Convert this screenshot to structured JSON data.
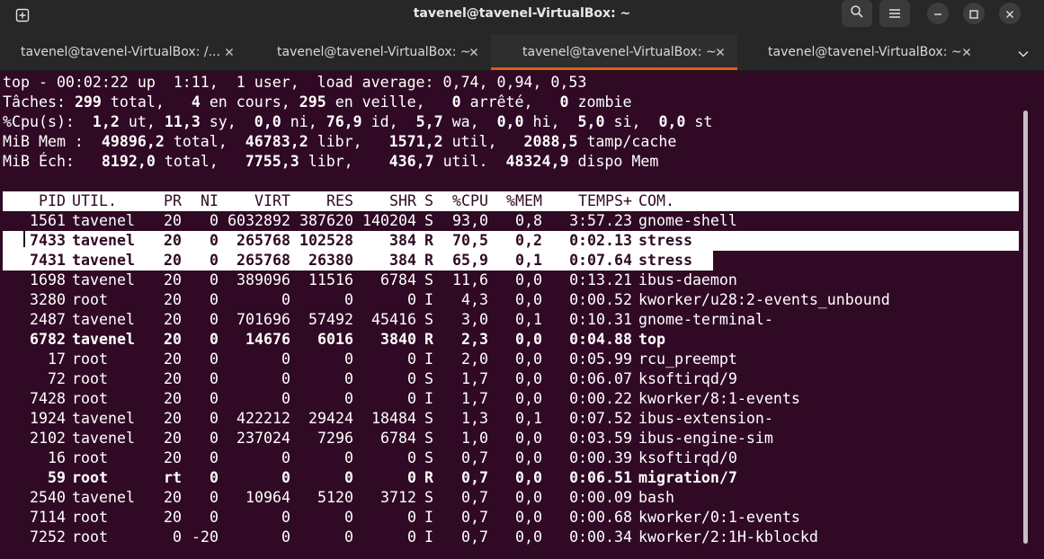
{
  "window": {
    "title": "tavenel@tavenel-VirtualBox: ~"
  },
  "tabs": [
    {
      "label": "tavenel@tavenel-VirtualBox: /...",
      "active": false
    },
    {
      "label": "tavenel@tavenel-VirtualBox: ~",
      "active": false
    },
    {
      "label": "tavenel@tavenel-VirtualBox: ~",
      "active": true
    },
    {
      "label": "tavenel@tavenel-VirtualBox: ~",
      "active": false
    }
  ],
  "icons": {
    "new_tab": "new-tab-icon",
    "search": "search-icon",
    "menu": "hamburger-menu-icon",
    "minimize": "minimize-icon",
    "maximize": "maximize-icon",
    "close": "close-icon",
    "tab_close": "close-icon",
    "tabs_menu": "chevron-down-icon"
  },
  "summary": {
    "line1": "top - 00:02:22 up  1:11,  1 user,  load average: 0,74, 0,94, 0,53",
    "tasks_label": "Tâches: ",
    "tasks_total": "299",
    "tasks_total_label": " total,   ",
    "tasks_running": "4",
    "tasks_running_label": " en cours, ",
    "tasks_sleeping": "295",
    "tasks_sleeping_label": " en veille,   ",
    "tasks_stopped": "0",
    "tasks_stopped_label": " arrêté,   ",
    "tasks_zombie": "0",
    "tasks_zombie_label": " zombie",
    "cpu_label": "%Cpu(s):  ",
    "cpu_us": "1,2",
    "cpu_us_label": " ut, ",
    "cpu_sy": "11,3",
    "cpu_sy_label": " sy,  ",
    "cpu_ni": "0,0",
    "cpu_ni_label": " ni, ",
    "cpu_id": "76,9",
    "cpu_id_label": " id,  ",
    "cpu_wa": "5,7",
    "cpu_wa_label": " wa,  ",
    "cpu_hi": "0,0",
    "cpu_hi_label": " hi,  ",
    "cpu_si": "5,0",
    "cpu_si_label": " si,  ",
    "cpu_st": "0,0",
    "cpu_st_label": " st",
    "mem_label": "MiB Mem :  ",
    "mem_total": "49896,2",
    "mem_total_label": " total,  ",
    "mem_free": "46783,2",
    "mem_free_label": " libr,   ",
    "mem_used": "1571,2",
    "mem_used_label": " util,   ",
    "mem_cache": "2088,5",
    "mem_cache_label": " tamp/cache",
    "swap_label": "MiB Éch:   ",
    "swap_total": "8192,0",
    "swap_total_label": " total,   ",
    "swap_free": "7755,3",
    "swap_free_label": " libr,    ",
    "swap_used": "436,7",
    "swap_used_label": " util.  ",
    "swap_avail": "48324,9",
    "swap_avail_label": " dispo Mem"
  },
  "table": {
    "headers": [
      "PID",
      "UTIL.",
      "PR",
      "NI",
      "VIRT",
      "RES",
      "SHR",
      "S",
      "%CPU",
      "%MEM",
      "TEMPS+",
      "COM."
    ],
    "rows": [
      {
        "pid": "1561",
        "user": "tavenel",
        "pr": "20",
        "ni": "0",
        "virt": "6032892",
        "res": "387620",
        "shr": "140204",
        "s": "S",
        "cpu": "93,0",
        "mem": "0,8",
        "time": "3:57.23",
        "cmd": "gnome-shell",
        "bold": false,
        "highlight": false
      },
      {
        "pid": "7433",
        "user": "tavenel",
        "pr": "20",
        "ni": "0",
        "virt": "265768",
        "res": "102528",
        "shr": "384",
        "s": "R",
        "cpu": "70,5",
        "mem": "0,2",
        "time": "0:02.13",
        "cmd": "stress",
        "bold": true,
        "highlight": true
      },
      {
        "pid": "7431",
        "user": "tavenel",
        "pr": "20",
        "ni": "0",
        "virt": "265768",
        "res": "26380",
        "shr": "384",
        "s": "R",
        "cpu": "65,9",
        "mem": "0,1",
        "time": "0:07.64",
        "cmd": "stress",
        "bold": true,
        "highlight": true
      },
      {
        "pid": "1698",
        "user": "tavenel",
        "pr": "20",
        "ni": "0",
        "virt": "389096",
        "res": "11516",
        "shr": "6784",
        "s": "S",
        "cpu": "11,6",
        "mem": "0,0",
        "time": "0:13.21",
        "cmd": "ibus-daemon",
        "bold": false,
        "highlight": false
      },
      {
        "pid": "3280",
        "user": "root",
        "pr": "20",
        "ni": "0",
        "virt": "0",
        "res": "0",
        "shr": "0",
        "s": "I",
        "cpu": "4,3",
        "mem": "0,0",
        "time": "0:00.52",
        "cmd": "kworker/u28:2-events_unbound",
        "bold": false,
        "highlight": false
      },
      {
        "pid": "2487",
        "user": "tavenel",
        "pr": "20",
        "ni": "0",
        "virt": "701696",
        "res": "57492",
        "shr": "45416",
        "s": "S",
        "cpu": "3,0",
        "mem": "0,1",
        "time": "0:10.31",
        "cmd": "gnome-terminal-",
        "bold": false,
        "highlight": false
      },
      {
        "pid": "6782",
        "user": "tavenel",
        "pr": "20",
        "ni": "0",
        "virt": "14676",
        "res": "6016",
        "shr": "3840",
        "s": "R",
        "cpu": "2,3",
        "mem": "0,0",
        "time": "0:04.88",
        "cmd": "top",
        "bold": true,
        "highlight": false
      },
      {
        "pid": "17",
        "user": "root",
        "pr": "20",
        "ni": "0",
        "virt": "0",
        "res": "0",
        "shr": "0",
        "s": "I",
        "cpu": "2,0",
        "mem": "0,0",
        "time": "0:05.99",
        "cmd": "rcu_preempt",
        "bold": false,
        "highlight": false
      },
      {
        "pid": "72",
        "user": "root",
        "pr": "20",
        "ni": "0",
        "virt": "0",
        "res": "0",
        "shr": "0",
        "s": "S",
        "cpu": "1,7",
        "mem": "0,0",
        "time": "0:06.07",
        "cmd": "ksoftirqd/9",
        "bold": false,
        "highlight": false
      },
      {
        "pid": "7428",
        "user": "root",
        "pr": "20",
        "ni": "0",
        "virt": "0",
        "res": "0",
        "shr": "0",
        "s": "I",
        "cpu": "1,7",
        "mem": "0,0",
        "time": "0:00.22",
        "cmd": "kworker/8:1-events",
        "bold": false,
        "highlight": false
      },
      {
        "pid": "1924",
        "user": "tavenel",
        "pr": "20",
        "ni": "0",
        "virt": "422212",
        "res": "29424",
        "shr": "18484",
        "s": "S",
        "cpu": "1,3",
        "mem": "0,1",
        "time": "0:07.52",
        "cmd": "ibus-extension-",
        "bold": false,
        "highlight": false
      },
      {
        "pid": "2102",
        "user": "tavenel",
        "pr": "20",
        "ni": "0",
        "virt": "237024",
        "res": "7296",
        "shr": "6784",
        "s": "S",
        "cpu": "1,0",
        "mem": "0,0",
        "time": "0:03.59",
        "cmd": "ibus-engine-sim",
        "bold": false,
        "highlight": false
      },
      {
        "pid": "16",
        "user": "root",
        "pr": "20",
        "ni": "0",
        "virt": "0",
        "res": "0",
        "shr": "0",
        "s": "S",
        "cpu": "0,7",
        "mem": "0,0",
        "time": "0:00.39",
        "cmd": "ksoftirqd/0",
        "bold": false,
        "highlight": false
      },
      {
        "pid": "59",
        "user": "root",
        "pr": "rt",
        "ni": "0",
        "virt": "0",
        "res": "0",
        "shr": "0",
        "s": "R",
        "cpu": "0,7",
        "mem": "0,0",
        "time": "0:06.51",
        "cmd": "migration/7",
        "bold": true,
        "highlight": false
      },
      {
        "pid": "2540",
        "user": "tavenel",
        "pr": "20",
        "ni": "0",
        "virt": "10964",
        "res": "5120",
        "shr": "3712",
        "s": "S",
        "cpu": "0,7",
        "mem": "0,0",
        "time": "0:00.09",
        "cmd": "bash",
        "bold": false,
        "highlight": false
      },
      {
        "pid": "7114",
        "user": "root",
        "pr": "20",
        "ni": "0",
        "virt": "0",
        "res": "0",
        "shr": "0",
        "s": "I",
        "cpu": "0,7",
        "mem": "0,0",
        "time": "0:00.68",
        "cmd": "kworker/0:1-events",
        "bold": false,
        "highlight": false
      },
      {
        "pid": "7252",
        "user": "root",
        "pr": "0",
        "ni": "-20",
        "virt": "0",
        "res": "0",
        "shr": "0",
        "s": "I",
        "cpu": "0,7",
        "mem": "0,0",
        "time": "0:00.34",
        "cmd": "kworker/2:1H-kblockd",
        "bold": false,
        "highlight": false
      }
    ]
  }
}
